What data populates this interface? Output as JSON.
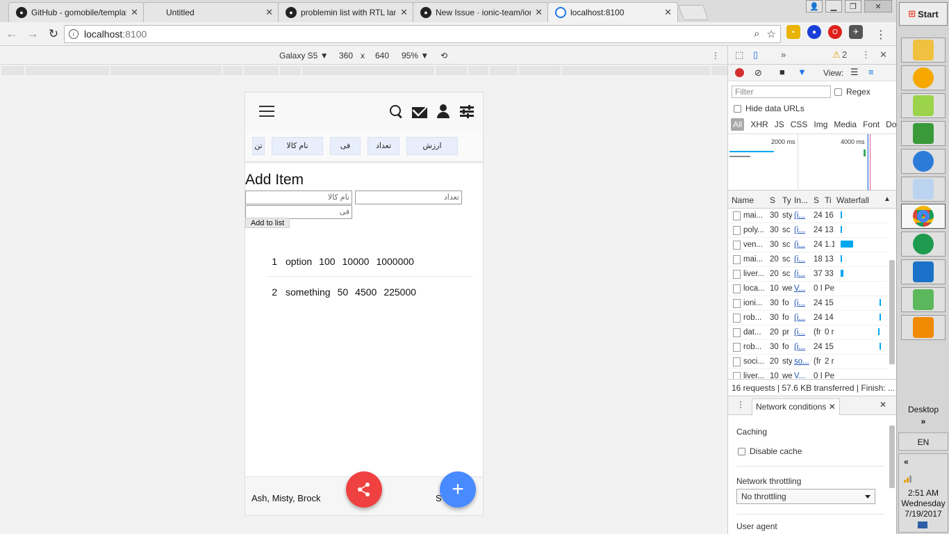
{
  "browser": {
    "tabs": [
      {
        "title": "GitHub - gomobile/template",
        "icon": "github-icon"
      },
      {
        "title": "Untitled",
        "icon": "blank-page-icon"
      },
      {
        "title": "problemin list with RTL langu",
        "icon": "github-icon"
      },
      {
        "title": "New Issue · ionic-team/ionic",
        "icon": "github-icon"
      },
      {
        "title": "localhost:8100",
        "icon": "localhost-icon"
      }
    ],
    "url_host": "localhost",
    "url_port": ":8100"
  },
  "device_toolbar": {
    "device": "Galaxy S5",
    "width": "360",
    "times": "x",
    "height": "640",
    "zoom": "95%"
  },
  "app": {
    "chips": [
      "تن",
      "نام کالا",
      "فی",
      "تعداد",
      "ارزش"
    ],
    "add_title": "Add Item",
    "name_placeholder": "نام کالا",
    "count_placeholder": "تعداد",
    "price_placeholder": "فی",
    "add_button": "Add to list",
    "rows": [
      {
        "num": "1",
        "name": "option",
        "count": "100",
        "price": "10000",
        "total": "1000000"
      },
      {
        "num": "2",
        "name": "something",
        "count": "50",
        "price": "4500",
        "total": "225000"
      }
    ],
    "footer_names": "Ash, Misty, Brock",
    "footer_cut": "S",
    "colors": {
      "share_fab": "#f04141",
      "add_fab": "#488aff"
    }
  },
  "devtools": {
    "warnings": "2",
    "view_label": "View:",
    "filter_placeholder": "Filter",
    "regex_label": "Regex",
    "hide_data_urls": "Hide data URLs",
    "types": [
      "All",
      "XHR",
      "JS",
      "CSS",
      "Img",
      "Media",
      "Font",
      "Do"
    ],
    "overview_labels": [
      "2000 ms",
      "4000 ms"
    ],
    "columns": [
      "Name",
      "S",
      "Ty",
      "In...",
      "S",
      "Ti",
      "Waterfall"
    ],
    "requests": [
      {
        "name": "mai...",
        "status": "30",
        "type": "sty",
        "init": "(i...",
        "size": "24",
        "time": "16"
      },
      {
        "name": "poly...",
        "status": "30",
        "type": "sc",
        "init": "(i...",
        "size": "24",
        "time": "13"
      },
      {
        "name": "ven...",
        "status": "30",
        "type": "sc",
        "init": "(i...",
        "size": "24",
        "time": "1.1"
      },
      {
        "name": "mai...",
        "status": "20",
        "type": "sc",
        "init": "(i...",
        "size": "18",
        "time": "13"
      },
      {
        "name": "liver...",
        "status": "20",
        "type": "sc",
        "init": "(i...",
        "size": "37",
        "time": "33"
      },
      {
        "name": "loca...",
        "status": "10",
        "type": "we",
        "init": "V...",
        "size": "0 I",
        "time": "Pe"
      },
      {
        "name": "ioni...",
        "status": "30",
        "type": "fo",
        "init": "(i...",
        "size": "24",
        "time": "15"
      },
      {
        "name": "rob...",
        "status": "30",
        "type": "fo",
        "init": "(i...",
        "size": "24",
        "time": "14"
      },
      {
        "name": "dat...",
        "status": "20",
        "type": "pr",
        "init": "(i...",
        "size": "(fr",
        "time": "0 r"
      },
      {
        "name": "rob...",
        "status": "30",
        "type": "fo",
        "init": "(i...",
        "size": "24",
        "time": "15"
      },
      {
        "name": "soci...",
        "status": "20",
        "type": "sty",
        "init": "so...",
        "size": "(fr",
        "time": "2 r"
      },
      {
        "name": "liver...",
        "status": "10",
        "type": "we",
        "init": "V...",
        "size": "0 I",
        "time": "Pe"
      }
    ],
    "summary": "16 requests  |  57.6 KB transferred  |  Finish: ...",
    "drawer_tab": "Network conditions",
    "caching_title": "Caching",
    "disable_cache": "Disable cache",
    "throttling_title": "Network throttling",
    "throttling_value": "No throttling",
    "user_agent_title": "User agent"
  },
  "taskbar": {
    "start": "Start",
    "desktop": "Desktop",
    "desktop_arrow": "»",
    "lang": "EN",
    "collapse": "«",
    "time": "2:51 AM",
    "day": "Wednesday",
    "date": "7/19/2017"
  }
}
